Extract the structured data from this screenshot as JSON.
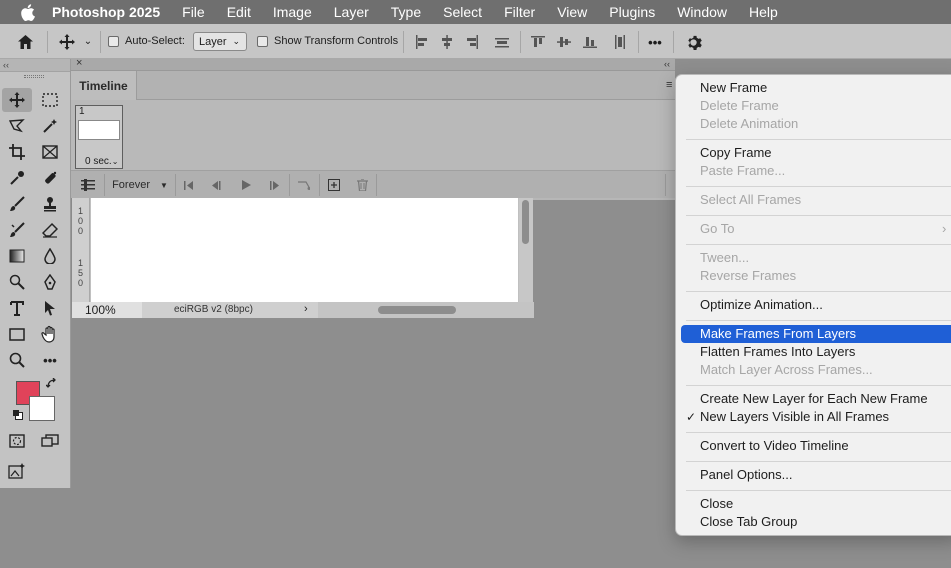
{
  "menubar": {
    "app_name": "Photoshop 2025",
    "items": [
      "File",
      "Edit",
      "Image",
      "Layer",
      "Type",
      "Select",
      "Filter",
      "View",
      "Plugins",
      "Window",
      "Help"
    ]
  },
  "options_bar": {
    "auto_select_label": "Auto-Select:",
    "auto_select_value": "Layer",
    "show_transform_label": "Show Transform Controls",
    "more_label": "•••"
  },
  "timeline": {
    "tab_label": "Timeline",
    "frame_number": "1",
    "frame_delay": "0 sec.",
    "loop_value": "Forever"
  },
  "document": {
    "zoom": "100%",
    "color_profile": "eciRGB v2 (8bpc)",
    "status_arrow": "›",
    "ruler_marks": [
      "1",
      "0",
      "0",
      "1",
      "5",
      "0"
    ]
  },
  "colors": {
    "foreground": "#e0435a",
    "background": "#ffffff",
    "menu_highlight": "#1f5fd6"
  },
  "context_menu": {
    "items": [
      {
        "label": "New Frame",
        "disabled": false
      },
      {
        "label": "Delete Frame",
        "disabled": true
      },
      {
        "label": "Delete Animation",
        "disabled": true
      },
      {
        "label": "Copy Frame",
        "disabled": false
      },
      {
        "label": "Paste Frame...",
        "disabled": true
      },
      {
        "label": "Select All Frames",
        "disabled": true
      },
      {
        "label": "Go To",
        "disabled": true,
        "submenu": true
      },
      {
        "label": "Tween...",
        "disabled": true
      },
      {
        "label": "Reverse Frames",
        "disabled": true
      },
      {
        "label": "Optimize Animation...",
        "disabled": false
      },
      {
        "label": "Make Frames From Layers",
        "disabled": false,
        "highlighted": true
      },
      {
        "label": "Flatten Frames Into Layers",
        "disabled": false
      },
      {
        "label": "Match Layer Across Frames...",
        "disabled": true
      },
      {
        "label": "Create New Layer for Each New Frame",
        "disabled": false
      },
      {
        "label": "New Layers Visible in All Frames",
        "disabled": false,
        "checked": true
      },
      {
        "label": "Convert to Video Timeline",
        "disabled": false
      },
      {
        "label": "Panel Options...",
        "disabled": false
      },
      {
        "label": "Close",
        "disabled": false
      },
      {
        "label": "Close Tab Group",
        "disabled": false
      }
    ],
    "submenu_glyph": "›",
    "check_glyph": "✓"
  }
}
